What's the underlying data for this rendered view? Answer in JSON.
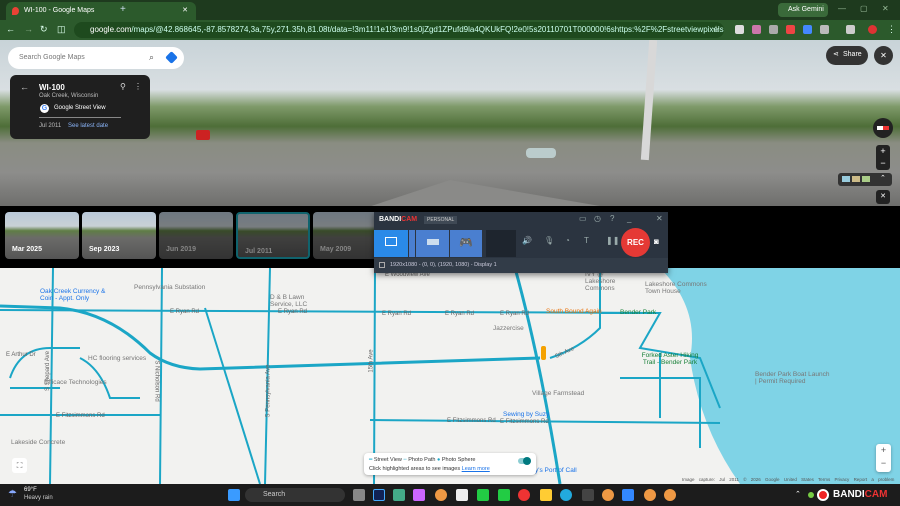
{
  "browser": {
    "tab_title": "WI-100 - Google Maps",
    "url_domain": "google.com",
    "url_path": "/maps/@42.868645,-87.8578274,3a,75y,271.35h,81.08t/data=!3m11!1e1!3m9!1s0jZgd1ZPufd9la4QKUkFQ!2e0!5s20110701T000000!6shttps:%2F%2Fstreetviewpixels-pa.googleapis.com%2Fv1%2...",
    "ask_gemini": "Ask Gemini"
  },
  "maps": {
    "search_placeholder": "Search Google Maps",
    "place_title": "WI-100",
    "place_subtitle": "Oak Creek, Wisconsin",
    "source": "Google Street View",
    "date": "Jul 2011",
    "see_latest": "See latest date",
    "share": "Share"
  },
  "timeline": [
    {
      "label": "Mar 2025"
    },
    {
      "label": "Sep 2023"
    },
    {
      "label": "Jun 2019"
    },
    {
      "label": "Jul 2011"
    },
    {
      "label": "May 2009"
    }
  ],
  "bandicam": {
    "brand_a": "BANDI",
    "brand_b": "CAM",
    "edition": "PERSONAL",
    "rec": "REC",
    "status": "1920x1080 - (0, 0), (1920, 1080) - Display 1"
  },
  "map": {
    "roads": [
      "E Ryan Rd",
      "E Ryan Rd",
      "E Ryan Rd",
      "E Ryan Rd",
      "E Ryan Rd",
      "E Fitzsimmons Rd",
      "E Fitzsimmons Rd",
      "E Fitzsimmons Rd",
      "S Shepard Ave",
      "S Nicholson Rd",
      "S Pennsylvania Ave",
      "15th Ave",
      "5th Ave",
      "E Woodview Ave",
      "E Arthur Dr"
    ],
    "pois": {
      "oak_creek": "Oak Creek Currency & Coin - Appt. Only",
      "penn_sub": "Pennsylvania Substation",
      "db_lawn": "D & B Lawn Service, LLC",
      "hc_floor": "HC flooring services",
      "efficace": "Efficace Technologies",
      "lakeside": "Lakeside Concrete",
      "ivy": "IVY @ Lakeshore Commons",
      "town_house": "Lakeshore Commons Town House",
      "south_bound": "South Bound Again",
      "bender": "Bender Park",
      "jazz": "Jazzercise",
      "forked": "Forked Aster Hiking Trail - Bender Park",
      "boat": "Bender Park Boat Launch | Permit Required",
      "village": "Village Farmstead",
      "sewing": "Sewing by Suzy",
      "port": "y's Port of Call"
    },
    "legend": {
      "street_view": "Street View",
      "photo_path": "Photo Path",
      "photo_sphere": "Photo Sphere",
      "hint": "Click highlighted areas to see images",
      "learn_more": "Learn more",
      "toggle_on": true
    },
    "footer": {
      "capture": "Image capture: Jul 2011",
      "copyright": "© 2026 Google",
      "country": "United States",
      "terms": "Terms",
      "privacy": "Privacy",
      "report": "Report a problem"
    }
  },
  "taskbar": {
    "temp": "69°F",
    "weather": "Heavy rain",
    "search": "Search"
  },
  "colors": {
    "coverage": "#1ba6c6",
    "water": "#7fd3e6",
    "rec": "#e53935",
    "accent": "#1a73e8"
  }
}
